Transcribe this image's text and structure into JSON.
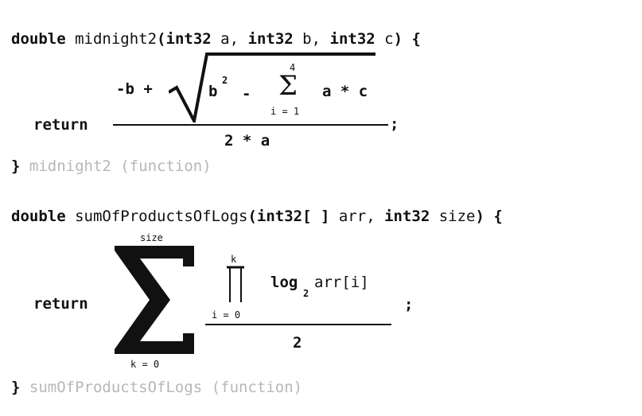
{
  "functions": [
    {
      "return_type": "double",
      "name": "midnight2",
      "params": [
        {
          "type": "int32",
          "name": "a"
        },
        {
          "type": "int32",
          "name": "b"
        },
        {
          "type": "int32",
          "name": "c"
        }
      ],
      "open_brace": "{",
      "return_kw": "return",
      "numerator_prefix": "-b +",
      "radicand": {
        "base": "b",
        "exponent": "2",
        "minus": "-",
        "sum_symbol": "Σ",
        "sum_upper": "4",
        "sum_lower": "i = 1",
        "sum_body": "a * c"
      },
      "denominator": "2 * a",
      "terminator": ";",
      "close_brace": "}",
      "close_comment": "midnight2 (function)"
    },
    {
      "return_type": "double",
      "name": "sumOfProductsOfLogs",
      "params": [
        {
          "type": "int32[ ]",
          "name": "arr"
        },
        {
          "type": "int32",
          "name": "size"
        }
      ],
      "open_brace": "{",
      "return_kw": "return",
      "sum": {
        "symbol": "Σ",
        "upper": "size",
        "lower": "k = 0"
      },
      "product": {
        "upper": "k",
        "lower": "i = 0"
      },
      "log": {
        "fn": "log",
        "base": "2",
        "arg": "arr[i]"
      },
      "denominator": "2",
      "terminator": ";",
      "close_brace": "}",
      "close_comment": "sumOfProductsOfLogs (function)"
    }
  ]
}
